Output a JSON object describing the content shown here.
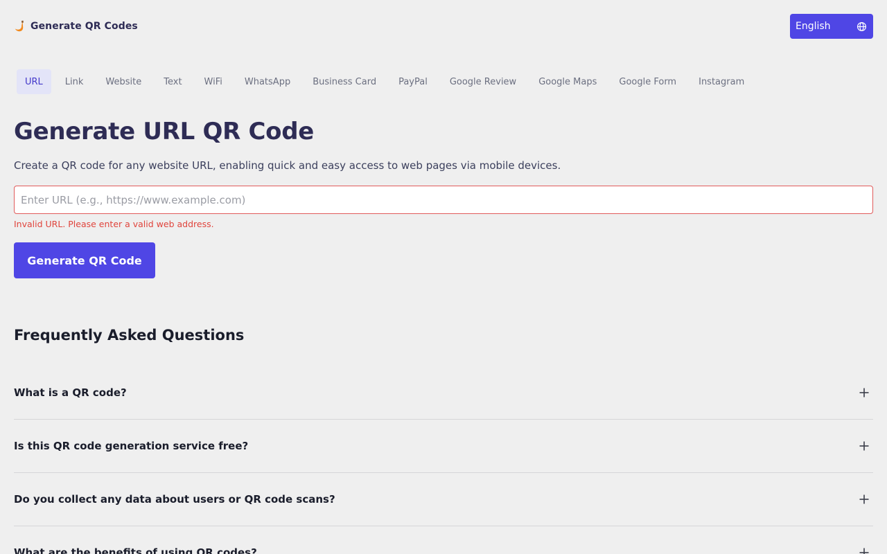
{
  "header": {
    "brand_name": "Generate QR Codes",
    "language_label": "English"
  },
  "tabs": [
    {
      "label": "URL",
      "active": true
    },
    {
      "label": "Link"
    },
    {
      "label": "Website"
    },
    {
      "label": "Text"
    },
    {
      "label": "WiFi"
    },
    {
      "label": "WhatsApp"
    },
    {
      "label": "Business Card"
    },
    {
      "label": "PayPal"
    },
    {
      "label": "Google Review"
    },
    {
      "label": "Google Maps"
    },
    {
      "label": "Google Form"
    },
    {
      "label": "Instagram"
    }
  ],
  "main": {
    "title": "Generate URL QR Code",
    "description": "Create a QR code for any website URL, enabling quick and easy access to web pages via mobile devices.",
    "url_input": {
      "value": "",
      "placeholder": "Enter URL (e.g., https://www.example.com)"
    },
    "error": "Invalid URL. Please enter a valid web address.",
    "generate_label": "Generate QR Code"
  },
  "faq": {
    "title": "Frequently Asked Questions",
    "items": [
      {
        "question": "What is a QR code?"
      },
      {
        "question": "Is this QR code generation service free?"
      },
      {
        "question": "Do you collect any data about users or QR code scans?"
      },
      {
        "question": "What are the benefits of using QR codes?"
      }
    ]
  },
  "icons": {
    "brand": "brand-logo-icon",
    "language": "globe-icon",
    "faq_toggle": "plus-icon"
  },
  "colors": {
    "accent": "#4f46e5",
    "title": "#2e2c55",
    "error": "#e0443c",
    "active_tab_bg": "#e3e4f8",
    "active_tab_text": "#4338ca",
    "background": "#efefef"
  }
}
